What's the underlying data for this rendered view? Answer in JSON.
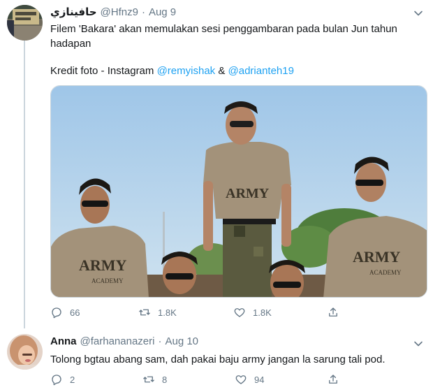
{
  "tweets": [
    {
      "display_name": "حافينازي",
      "handle": "@Hfnz9",
      "dot": "·",
      "date": "Aug 9",
      "text": "Filem 'Bakara' akan memulakan sesi penggambaran pada bulan Jun tahun hadapan",
      "credit_prefix": "Kredit foto - Instagram ",
      "mention_1": "@remyishak",
      "credit_joiner": " & ",
      "mention_2": "@adrianteh19",
      "media": {
        "shirt_text": "ARMY",
        "shirt_subtext": "ACADEMY"
      },
      "actions": {
        "reply_count": "66",
        "retweet_count": "1.8K",
        "like_count": "1.8K"
      }
    },
    {
      "display_name": "Anna",
      "handle": "@farhananazeri",
      "dot": "·",
      "date": "Aug 10",
      "text": "Tolong bgtau abang sam, dah pakai baju army jangan la sarung tali pod.",
      "actions": {
        "reply_count": "2",
        "retweet_count": "8",
        "like_count": "94"
      }
    }
  ],
  "colors": {
    "link": "#1da1f2",
    "secondary_text": "#657786",
    "thread_line": "#ccd6dd"
  },
  "icons": [
    "caret-down-icon",
    "reply-icon",
    "retweet-icon",
    "like-icon",
    "share-icon"
  ]
}
